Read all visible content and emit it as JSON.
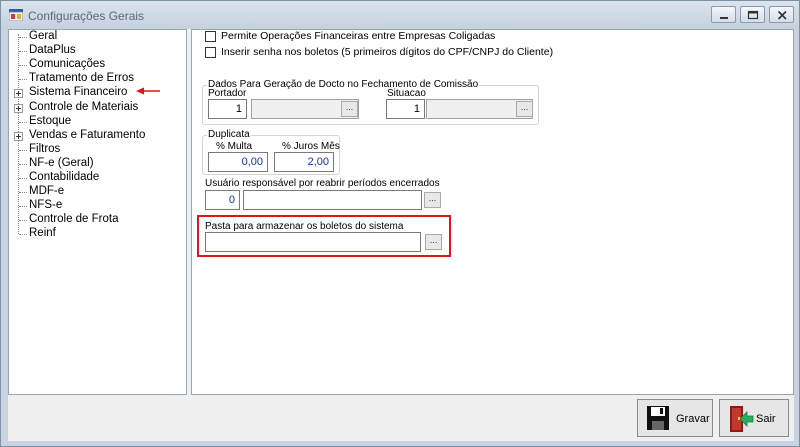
{
  "window": {
    "title": "Configurações Gerais"
  },
  "tree": {
    "items": [
      {
        "label": "Geral",
        "expandable": false
      },
      {
        "label": "DataPlus",
        "expandable": false
      },
      {
        "label": "Comunicações",
        "expandable": false
      },
      {
        "label": "Tratamento de Erros",
        "expandable": false
      },
      {
        "label": "Sistema Financeiro",
        "expandable": true
      },
      {
        "label": "Controle de Materiais",
        "expandable": true
      },
      {
        "label": "Estoque",
        "expandable": false
      },
      {
        "label": "Vendas e Faturamento",
        "expandable": true
      },
      {
        "label": "Filtros",
        "expandable": false
      },
      {
        "label": "NF-e (Geral)",
        "expandable": false
      },
      {
        "label": "Contabilidade",
        "expandable": false
      },
      {
        "label": "MDF-e",
        "expandable": false
      },
      {
        "label": "NFS-e",
        "expandable": false
      },
      {
        "label": "Controle de Frota",
        "expandable": false
      },
      {
        "label": "Reinf",
        "expandable": false
      }
    ]
  },
  "options": {
    "coligadas_label": "Permite Operações Financeiras entre Empresas Coligadas",
    "senha_boletos_label": "Inserir senha nos boletos (5 primeiros dígitos do CPF/CNPJ do Cliente)"
  },
  "geracao": {
    "title": "Dados Para Geração de Docto no Fechamento de Comissão",
    "portador_label": "Portador",
    "portador_value": "1",
    "situacao_label": "Situacao",
    "situacao_value": "1"
  },
  "duplicata": {
    "title": "Duplicata",
    "multa_label": "% Multa",
    "multa_value": "0,00",
    "juros_label": "% Juros Mês",
    "juros_value": "2,00"
  },
  "usuario": {
    "label": "Usuário responsável por reabrir períodos encerrados",
    "value": "0"
  },
  "pasta": {
    "label": "Pasta para armazenar os boletos do sistema",
    "value": ""
  },
  "buttons": {
    "browse": "...",
    "gravar": "Gravar",
    "sair": "Sair"
  },
  "colors": {
    "highlight": "#e01515",
    "value_blue": "#1133aa"
  }
}
